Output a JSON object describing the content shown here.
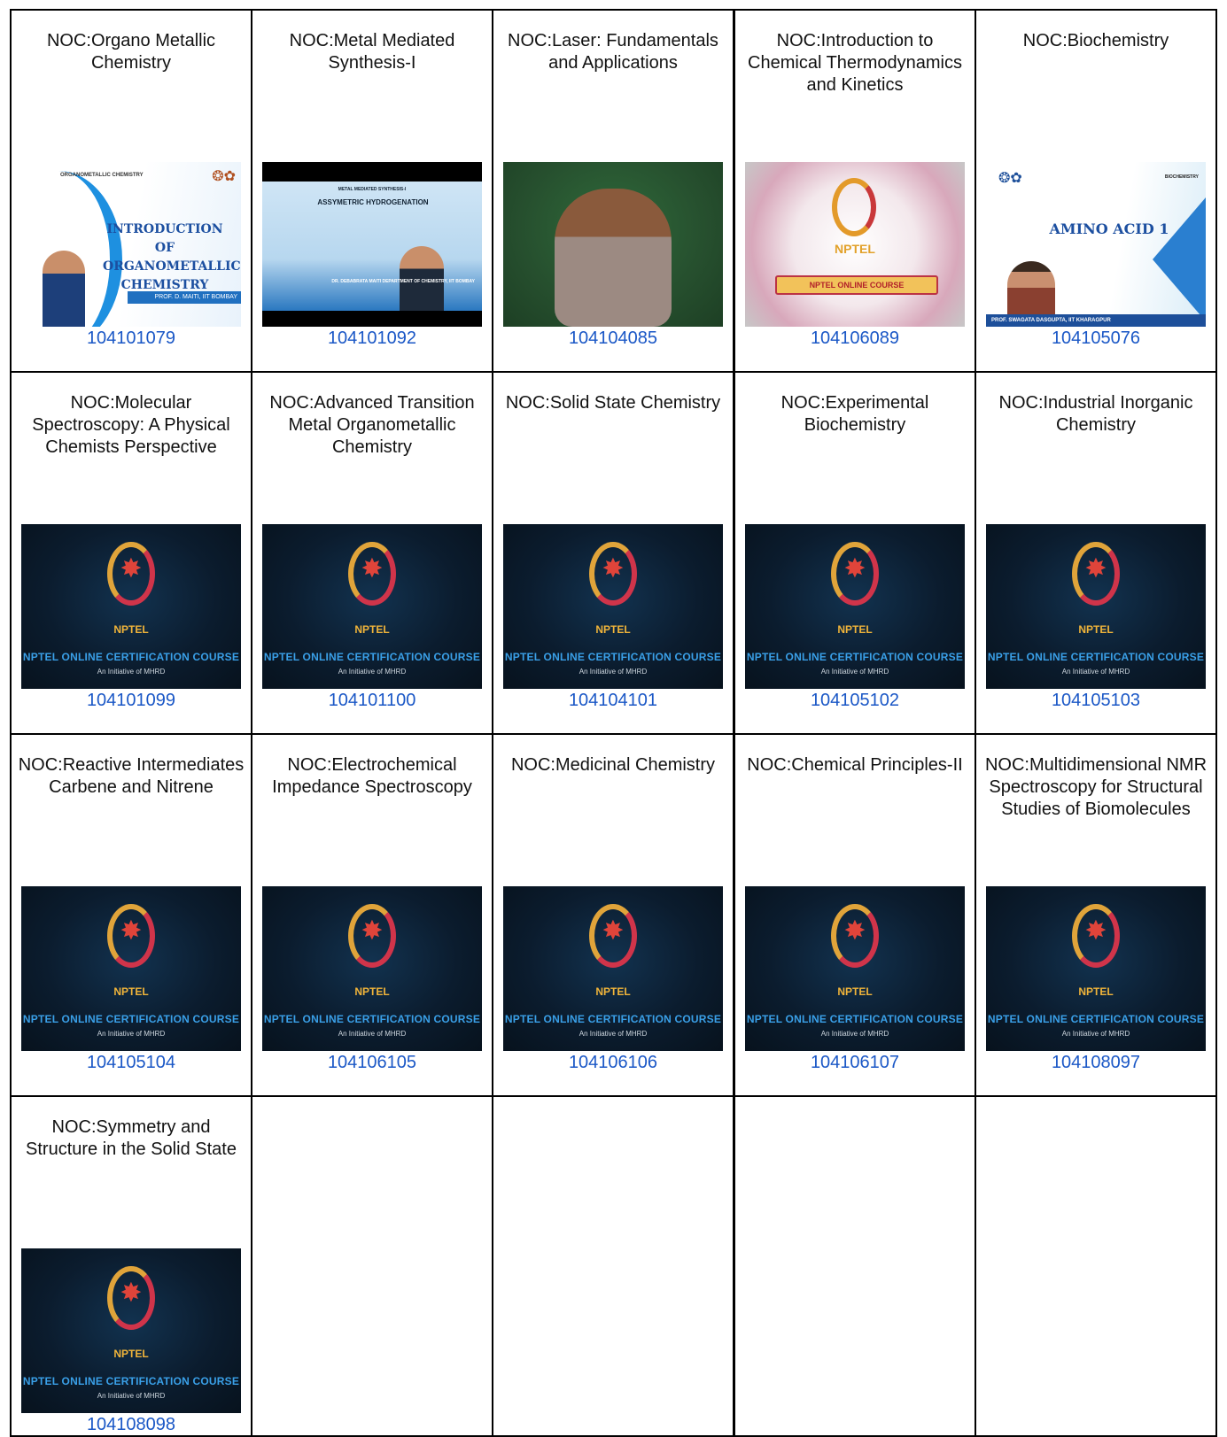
{
  "courses": [
    {
      "title": "NOC:Organo Metallic Chemistry",
      "code": "104101079",
      "thumb": "om",
      "thumb_text": {
        "header": "ORGANOMETALLIC CHEMISTRY",
        "title": "INTRODUCTION OF ORGANOMETALLIC CHEMISTRY",
        "credit": "PROF. D. MAITI, IIT BOMBAY"
      }
    },
    {
      "title": "NOC:Metal Mediated Synthesis-I",
      "code": "104101092",
      "thumb": "msi",
      "thumb_text": {
        "header": "METAL MEDIATED SYNTHESIS-I",
        "title": "ASSYMETRIC HYDROGENATION",
        "credit": "DR. DEBABRATA MAITI DEPARTMENT OF CHEMISTRY, IIT BOMBAY"
      }
    },
    {
      "title": "NOC:Laser: Fundamentals and Applications",
      "code": "104104085",
      "thumb": "laser"
    },
    {
      "title": "NOC:Introduction to Chemical Thermodynamics and Kinetics",
      "code": "104106089",
      "thumb": "thermo",
      "thumb_text": {
        "brand": "NPTEL",
        "banner": "NPTEL ONLINE COURSE"
      }
    },
    {
      "title": "NOC:Biochemistry",
      "code": "104105076",
      "thumb": "bio",
      "thumb_text": {
        "header": "BIOCHEMISTRY",
        "title": "AMINO ACID 1",
        "credit": "PROF. SWAGATA DASGUPTA, IIT KHARAGPUR"
      }
    },
    {
      "title": "NOC:Molecular Spectroscopy: A Physical Chemists Perspective",
      "code": "104101099",
      "thumb": "nptel"
    },
    {
      "title": "NOC:Advanced Transition Metal Organometallic Chemistry",
      "code": "104101100",
      "thumb": "nptel"
    },
    {
      "title": "NOC:Solid State Chemistry",
      "code": "104104101",
      "thumb": "nptel"
    },
    {
      "title": "NOC:Experimental Biochemistry",
      "code": "104105102",
      "thumb": "nptel"
    },
    {
      "title": "NOC:Industrial Inorganic Chemistry",
      "code": "104105103",
      "thumb": "nptel"
    },
    {
      "title": "NOC:Reactive Intermediates Carbene and Nitrene",
      "code": "104105104",
      "thumb": "nptel"
    },
    {
      "title": "NOC:Electrochemical Impedance Spectroscopy",
      "code": "104106105",
      "thumb": "nptel"
    },
    {
      "title": "NOC:Medicinal Chemistry",
      "code": "104106106",
      "thumb": "nptel"
    },
    {
      "title": "NOC:Chemical Principles-II",
      "code": "104106107",
      "thumb": "nptel"
    },
    {
      "title": "NOC:Multidimensional NMR Spectroscopy for Structural Studies of Biomolecules",
      "code": "104108097",
      "thumb": "nptel"
    },
    {
      "title": "NOC:Symmetry and Structure in the Solid State",
      "code": "104108098",
      "thumb": "nptel"
    }
  ],
  "nptel_thumb": {
    "brand": "NPTEL",
    "course": "NPTEL ONLINE CERTIFICATION COURSE",
    "initiative": "An Initiative of MHRD"
  },
  "colors": {
    "link": "#1a57c6",
    "border": "#000000"
  }
}
